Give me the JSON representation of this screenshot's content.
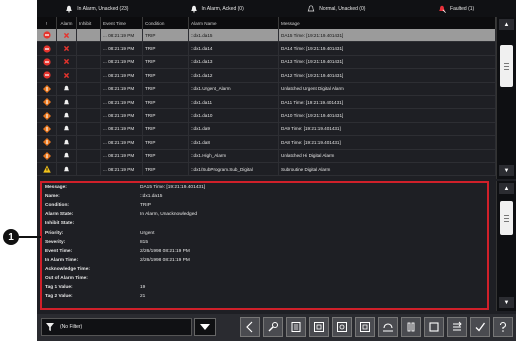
{
  "summary_tabs": [
    {
      "label": "In Alarm, Unacked (23)",
      "icon": "bell-icon",
      "color": "#e8e8e8"
    },
    {
      "label": "In Alarm, Acked (0)",
      "icon": "bell-icon",
      "color": "#e8e8e8"
    },
    {
      "label": "Normal, Unacked (0)",
      "icon": "bell-outline-icon",
      "color": "#e8e8e8"
    },
    {
      "label": "Faulted (1)",
      "icon": "bell-fault-icon",
      "color": "#e8303a"
    }
  ],
  "grid": {
    "headers": [
      "!",
      "Alarm",
      "Inhibit",
      "Event Time",
      "Condition",
      "Alarm Name",
      "Message"
    ],
    "rows": [
      {
        "severity": "urgent",
        "alarm": "x",
        "inhibit": "",
        "time": "... 08:21:19 PM",
        "condition": "TRIP",
        "name": "::dx1.da15",
        "message": "DA15 Time: [19:21:19.401431]",
        "selected": true
      },
      {
        "severity": "urgent",
        "alarm": "x",
        "inhibit": "",
        "time": "... 08:21:19 PM",
        "condition": "TRIP",
        "name": "::dx1.da14",
        "message": "DA14 Time: [19:21:19.401431]",
        "selected": false
      },
      {
        "severity": "urgent",
        "alarm": "x",
        "inhibit": "",
        "time": "... 08:21:19 PM",
        "condition": "TRIP",
        "name": "::dx1.da13",
        "message": "DA13 Time: [19:21:19.401431]",
        "selected": false
      },
      {
        "severity": "urgent",
        "alarm": "x",
        "inhibit": "",
        "time": "... 08:21:19 PM",
        "condition": "TRIP",
        "name": "::dx1.da12",
        "message": "DA12 Time: [19:21:19.401431]",
        "selected": false
      },
      {
        "severity": "high",
        "alarm": "bell",
        "inhibit": "",
        "time": "... 08:21:19 PM",
        "condition": "TRIP",
        "name": "::dx1.Urgent_Alarm",
        "message": "Unlatched Urgent Digital Alarm",
        "selected": false
      },
      {
        "severity": "high",
        "alarm": "bell",
        "inhibit": "",
        "time": "... 08:21:19 PM",
        "condition": "TRIP",
        "name": "::dx1.da11",
        "message": "DA11 Time: [19:21:19.401431]",
        "selected": false
      },
      {
        "severity": "high",
        "alarm": "bell",
        "inhibit": "",
        "time": "... 08:21:19 PM",
        "condition": "TRIP",
        "name": "::dx1.da10",
        "message": "DA10 Time: [19:21:19.401431]",
        "selected": false
      },
      {
        "severity": "high",
        "alarm": "bell",
        "inhibit": "",
        "time": "... 08:21:19 PM",
        "condition": "TRIP",
        "name": "::dx1.da9",
        "message": "DA9 Time: [19:21:19.401431]",
        "selected": false
      },
      {
        "severity": "high",
        "alarm": "bell",
        "inhibit": "",
        "time": "... 08:21:19 PM",
        "condition": "TRIP",
        "name": "::dx1.da8",
        "message": "DA8 Time: [19:21:19.401431]",
        "selected": false
      },
      {
        "severity": "high",
        "alarm": "bell",
        "inhibit": "",
        "time": "... 08:21:19 PM",
        "condition": "TRIP",
        "name": "::dx1.High_Alarm",
        "message": "Unlatched Hi Digital Alarm",
        "selected": false
      },
      {
        "severity": "medium",
        "alarm": "bell",
        "inhibit": "",
        "time": "... 08:21:19 PM",
        "condition": "TRIP",
        "name": "::dx1/SubProgram.Sub_Digital",
        "message": "Subroutine Digital Alarm",
        "selected": false
      }
    ]
  },
  "details": [
    {
      "label": "Message:",
      "value": "DA15 Time: [19:21:19.401431]"
    },
    {
      "label": "Name:",
      "value": "::dx1.da15"
    },
    {
      "label": "Condition:",
      "value": "TRIP"
    },
    {
      "label": "Alarm State:",
      "value": "In Alarm, Unacknowledged"
    },
    {
      "label": "Inhibit State:",
      "value": ""
    },
    {
      "label": "Priority:",
      "value": "Urgent"
    },
    {
      "label": "Severity:",
      "value": "815"
    },
    {
      "label": "Event Time:",
      "value": "2/26/1998 08:21:19 PM"
    },
    {
      "label": "In Alarm Time:",
      "value": "2/26/1998 08:21:19 PM"
    },
    {
      "label": "Acknowledge Time:",
      "value": ""
    },
    {
      "label": "Out of Alarm Time:",
      "value": ""
    },
    {
      "label": "Tag 1 Value:",
      "value": "19"
    },
    {
      "label": "Tag 2 Value:",
      "value": "21"
    }
  ],
  "callout": {
    "number": "1"
  },
  "toolbar": {
    "filter_label": "(No Filter)",
    "buttons": [
      "back-icon",
      "tools-icon",
      "ack-page-icon",
      "ack-selected-icon",
      "ack-all-icon",
      "inhibit-icon",
      "reset-icon",
      "pause-icon",
      "stop-icon",
      "sort-icon",
      "check-icon",
      "help-icon"
    ]
  },
  "colors": {
    "urgent": "#e5342d",
    "high": "#e8771e",
    "medium": "#f2c21a",
    "selected_row": "#9b9b9b",
    "highlight_border": "#d0202a"
  }
}
